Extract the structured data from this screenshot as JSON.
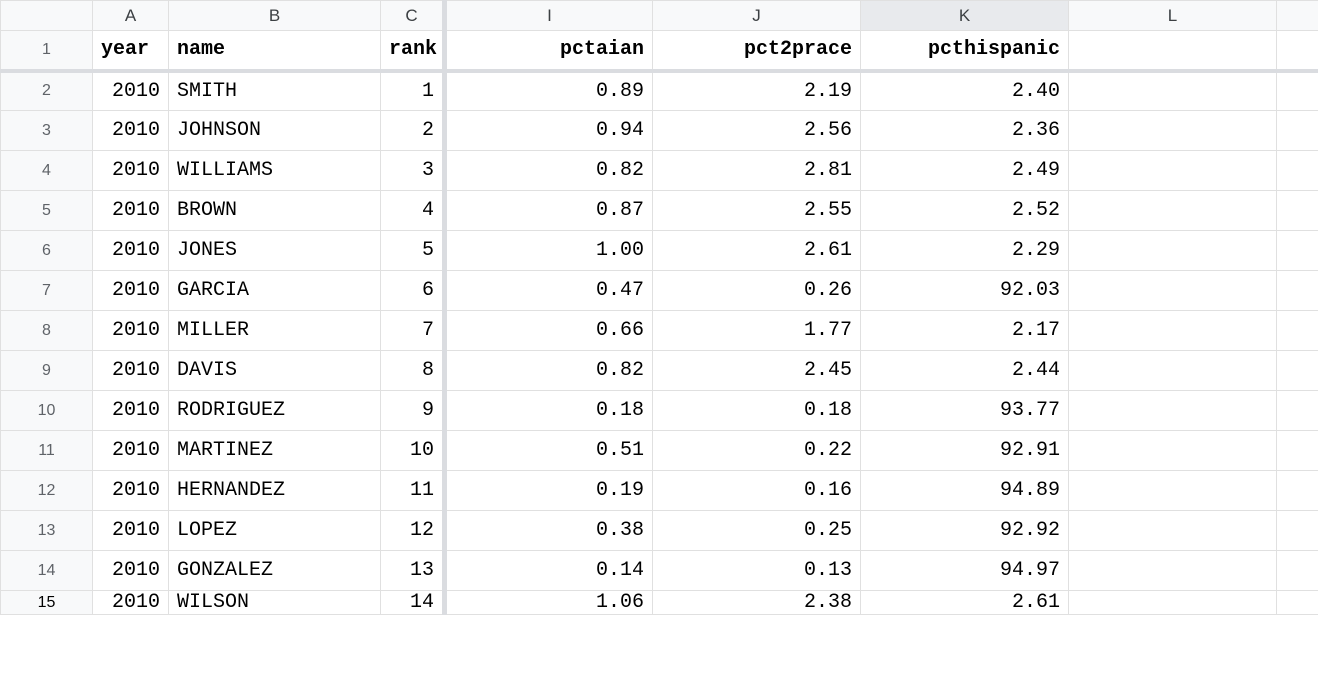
{
  "columns": {
    "rowhead": "",
    "A": "A",
    "B": "B",
    "C": "C",
    "I": "I",
    "J": "J",
    "K": "K",
    "L": "L"
  },
  "selected_column": "K",
  "header_row_number": "1",
  "headers": {
    "year": "year",
    "name": "name",
    "rank": "rank",
    "pctaian": "pctaian",
    "pct2prace": "pct2prace",
    "pcthispanic": "pcthispanic"
  },
  "rows": [
    {
      "n": "2",
      "year": "2010",
      "name": "SMITH",
      "rank": "1",
      "pctaian": "0.89",
      "pct2prace": "2.19",
      "pcthispanic": "2.40"
    },
    {
      "n": "3",
      "year": "2010",
      "name": "JOHNSON",
      "rank": "2",
      "pctaian": "0.94",
      "pct2prace": "2.56",
      "pcthispanic": "2.36"
    },
    {
      "n": "4",
      "year": "2010",
      "name": "WILLIAMS",
      "rank": "3",
      "pctaian": "0.82",
      "pct2prace": "2.81",
      "pcthispanic": "2.49"
    },
    {
      "n": "5",
      "year": "2010",
      "name": "BROWN",
      "rank": "4",
      "pctaian": "0.87",
      "pct2prace": "2.55",
      "pcthispanic": "2.52"
    },
    {
      "n": "6",
      "year": "2010",
      "name": "JONES",
      "rank": "5",
      "pctaian": "1.00",
      "pct2prace": "2.61",
      "pcthispanic": "2.29"
    },
    {
      "n": "7",
      "year": "2010",
      "name": "GARCIA",
      "rank": "6",
      "pctaian": "0.47",
      "pct2prace": "0.26",
      "pcthispanic": "92.03"
    },
    {
      "n": "8",
      "year": "2010",
      "name": "MILLER",
      "rank": "7",
      "pctaian": "0.66",
      "pct2prace": "1.77",
      "pcthispanic": "2.17"
    },
    {
      "n": "9",
      "year": "2010",
      "name": "DAVIS",
      "rank": "8",
      "pctaian": "0.82",
      "pct2prace": "2.45",
      "pcthispanic": "2.44"
    },
    {
      "n": "10",
      "year": "2010",
      "name": "RODRIGUEZ",
      "rank": "9",
      "pctaian": "0.18",
      "pct2prace": "0.18",
      "pcthispanic": "93.77"
    },
    {
      "n": "11",
      "year": "2010",
      "name": "MARTINEZ",
      "rank": "10",
      "pctaian": "0.51",
      "pct2prace": "0.22",
      "pcthispanic": "92.91"
    },
    {
      "n": "12",
      "year": "2010",
      "name": "HERNANDEZ",
      "rank": "11",
      "pctaian": "0.19",
      "pct2prace": "0.16",
      "pcthispanic": "94.89"
    },
    {
      "n": "13",
      "year": "2010",
      "name": "LOPEZ",
      "rank": "12",
      "pctaian": "0.38",
      "pct2prace": "0.25",
      "pcthispanic": "92.92"
    },
    {
      "n": "14",
      "year": "2010",
      "name": "GONZALEZ",
      "rank": "13",
      "pctaian": "0.14",
      "pct2prace": "0.13",
      "pcthispanic": "94.97"
    }
  ],
  "partial_row": {
    "n": "15",
    "year": "2010",
    "name": "WILSON",
    "rank": "14",
    "pctaian": "1.06",
    "pct2prace": "2.38",
    "pcthispanic": "2.61"
  }
}
